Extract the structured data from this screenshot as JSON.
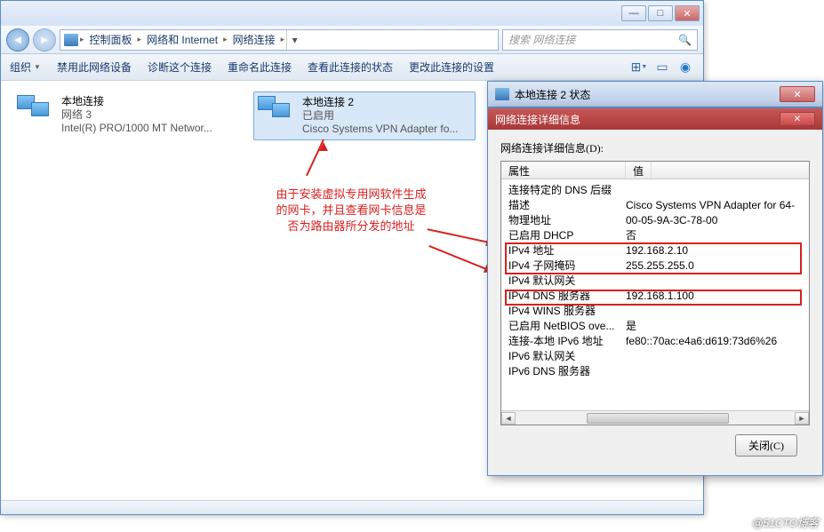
{
  "breadcrumb": {
    "p1": "控制面板",
    "p2": "网络和 Internet",
    "p3": "网络连接"
  },
  "search": {
    "placeholder": "搜索 网络连接"
  },
  "toolbar": {
    "org": "组织",
    "disable": "禁用此网络设备",
    "diag": "诊断这个连接",
    "rename": "重命名此连接",
    "status": "查看此连接的状态",
    "change": "更改此连接的设置"
  },
  "connections": [
    {
      "name": "本地连接",
      "line2": "网络 3",
      "line3": "Intel(R) PRO/1000 MT Networ..."
    },
    {
      "name": "本地连接 2",
      "line2": "已启用",
      "line3": "Cisco Systems VPN Adapter fo..."
    }
  ],
  "annotation": "由于安装虚拟专用网软件生成的网卡，并且查看网卡信息是否为路由器所分发的地址",
  "dialog1": {
    "title": "本地连接 2 状态"
  },
  "dialog2": {
    "title": "网络连接详细信息",
    "label": "网络连接详细信息(D):",
    "col1": "属性",
    "col2": "值",
    "rows": [
      {
        "p": "连接特定的 DNS 后缀",
        "v": ""
      },
      {
        "p": "描述",
        "v": "Cisco Systems VPN Adapter for 64-"
      },
      {
        "p": "物理地址",
        "v": "00-05-9A-3C-78-00"
      },
      {
        "p": "已启用 DHCP",
        "v": "否"
      },
      {
        "p": "IPv4 地址",
        "v": "192.168.2.10"
      },
      {
        "p": "IPv4 子网掩码",
        "v": "255.255.255.0"
      },
      {
        "p": "IPv4 默认网关",
        "v": ""
      },
      {
        "p": "IPv4 DNS 服务器",
        "v": "192.168.1.100"
      },
      {
        "p": "IPv4 WINS 服务器",
        "v": ""
      },
      {
        "p": "已启用 NetBIOS ove...",
        "v": "是"
      },
      {
        "p": "连接-本地 IPv6 地址",
        "v": "fe80::70ac:e4a6:d619:73d6%26"
      },
      {
        "p": "IPv6 默认网关",
        "v": ""
      },
      {
        "p": "IPv6 DNS 服务器",
        "v": ""
      }
    ],
    "close": "关闭(C)"
  },
  "watermark": "@51CTO博客"
}
